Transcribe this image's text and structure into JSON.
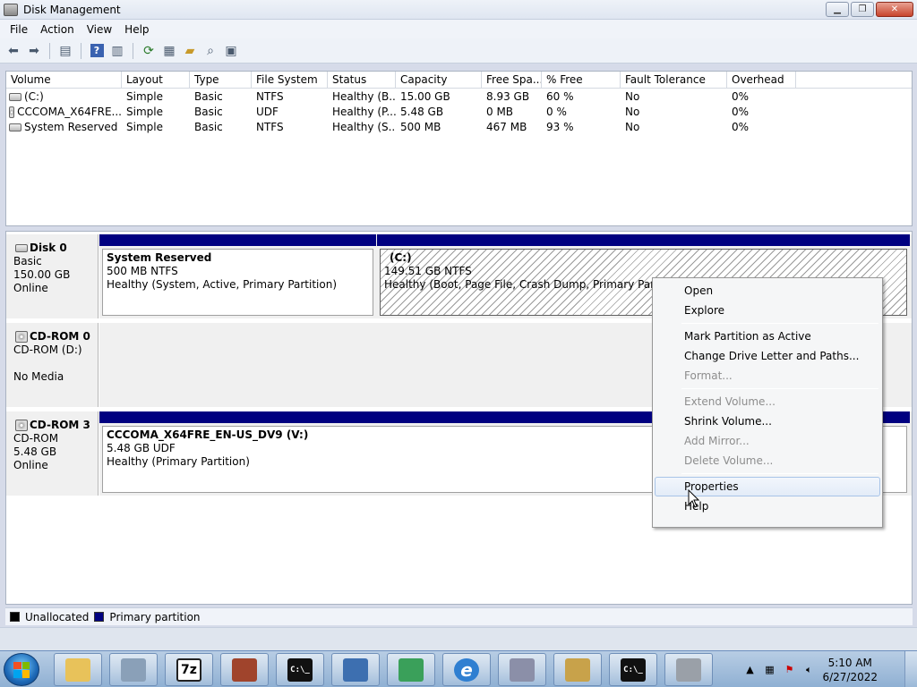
{
  "window": {
    "title": "Disk Management"
  },
  "menubar": [
    "File",
    "Action",
    "View",
    "Help"
  ],
  "volume_list": {
    "columns": [
      {
        "label": "Volume",
        "w": 129
      },
      {
        "label": "Layout",
        "w": 76
      },
      {
        "label": "Type",
        "w": 69
      },
      {
        "label": "File System",
        "w": 85
      },
      {
        "label": "Status",
        "w": 76
      },
      {
        "label": "Capacity",
        "w": 96
      },
      {
        "label": "Free Spa...",
        "w": 67
      },
      {
        "label": "% Free",
        "w": 88
      },
      {
        "label": "Fault Tolerance",
        "w": 119
      },
      {
        "label": "Overhead",
        "w": 77
      }
    ],
    "rows": [
      {
        "icon": "drive",
        "cells": [
          "(C:)",
          "Simple",
          "Basic",
          "NTFS",
          "Healthy (B...",
          "15.00 GB",
          "8.93 GB",
          "60 %",
          "No",
          "0%"
        ]
      },
      {
        "icon": "disc",
        "cells": [
          "CCCOMA_X64FRE...",
          "Simple",
          "Basic",
          "UDF",
          "Healthy (P...",
          "5.48 GB",
          "0 MB",
          "0 %",
          "No",
          "0%"
        ]
      },
      {
        "icon": "drive",
        "cells": [
          "System Reserved",
          "Simple",
          "Basic",
          "NTFS",
          "Healthy (S...",
          "500 MB",
          "467 MB",
          "93 %",
          "No",
          "0%"
        ]
      }
    ]
  },
  "disks": [
    {
      "name": "Disk 0",
      "lines": [
        "Basic",
        "150.00 GB",
        "Online"
      ],
      "partitions": [
        {
          "name": "System Reserved",
          "size": "500 MB NTFS",
          "status": "Healthy (System, Active, Primary Partition)"
        },
        {
          "name": "(C:)",
          "size": "149.51 GB NTFS",
          "status": "Healthy (Boot, Page File, Crash Dump, Primary Partition)"
        }
      ]
    },
    {
      "name": "CD-ROM 0",
      "lines": [
        "CD-ROM (D:)",
        "",
        "No Media"
      ],
      "partitions": []
    },
    {
      "name": "CD-ROM 3",
      "lines": [
        "CD-ROM",
        "5.48 GB",
        "Online"
      ],
      "partitions": [
        {
          "name": "CCCOMA_X64FRE_EN-US_DV9  (V:)",
          "size": "5.48 GB UDF",
          "status": "Healthy (Primary Partition)"
        }
      ]
    }
  ],
  "legend": {
    "unallocated": "Unallocated",
    "primary": "Primary partition",
    "unallocated_color": "#000000",
    "primary_color": "#000080"
  },
  "context_menu": {
    "items": [
      {
        "label": "Open",
        "enabled": true
      },
      {
        "label": "Explore",
        "enabled": true
      },
      {
        "sep": true
      },
      {
        "label": "Mark Partition as Active",
        "enabled": true
      },
      {
        "label": "Change Drive Letter and Paths...",
        "enabled": true
      },
      {
        "label": "Format...",
        "enabled": false
      },
      {
        "sep": true
      },
      {
        "label": "Extend Volume...",
        "enabled": false
      },
      {
        "label": "Shrink Volume...",
        "enabled": true
      },
      {
        "label": "Add Mirror...",
        "enabled": false
      },
      {
        "label": "Delete Volume...",
        "enabled": false
      },
      {
        "sep": true
      },
      {
        "label": "Properties",
        "enabled": true,
        "hover": true
      },
      {
        "label": "Help",
        "enabled": true
      }
    ]
  },
  "taskbar": {
    "apps": [
      {
        "name": "explorer",
        "icon": "folder-icon",
        "glyph": "",
        "color": "#e8c25a"
      },
      {
        "name": "media",
        "icon": "disk-utility-icon",
        "glyph": "",
        "color": "#8aa0b8"
      },
      {
        "name": "7zip",
        "icon": "7z-icon",
        "glyph": "7z",
        "color": "#222222"
      },
      {
        "name": "winrar",
        "icon": "archive-icon",
        "glyph": "",
        "color": "#a0442c"
      },
      {
        "name": "cmd1",
        "icon": "command-prompt-icon",
        "glyph": "C:\\_",
        "color": "#111111"
      },
      {
        "name": "computer",
        "icon": "computer-icon",
        "glyph": "",
        "color": "#3d6fb0"
      },
      {
        "name": "download",
        "icon": "download-icon",
        "glyph": "",
        "color": "#3aa05a"
      },
      {
        "name": "ie",
        "icon": "internet-explorer-icon",
        "glyph": "e",
        "color": "#2f7fd1"
      },
      {
        "name": "window",
        "icon": "window-app-icon",
        "glyph": "",
        "color": "#8b8fa8"
      },
      {
        "name": "drive",
        "icon": "drive-app-icon",
        "glyph": "",
        "color": "#c8a24a"
      },
      {
        "name": "cmd2",
        "icon": "command-prompt-icon",
        "glyph": "C:\\_",
        "color": "#111111"
      },
      {
        "name": "diskmgmt",
        "icon": "disk-management-icon",
        "glyph": "",
        "color": "#9aa0a8"
      }
    ],
    "clock": {
      "time": "5:10 AM",
      "date": "6/27/2022"
    }
  }
}
